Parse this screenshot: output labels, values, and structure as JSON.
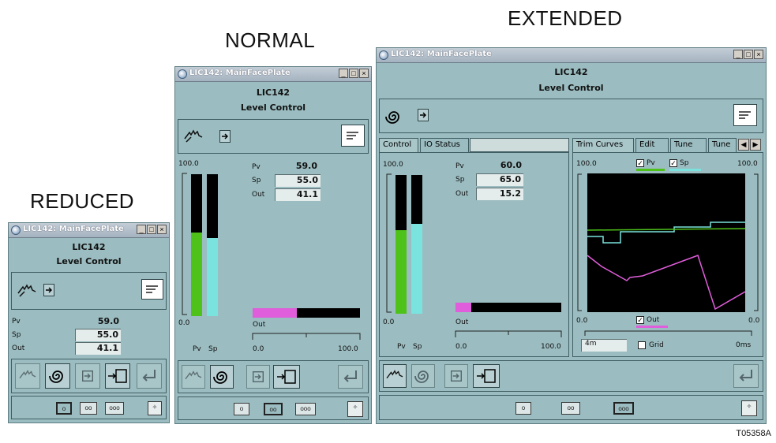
{
  "labels": {
    "reduced": "REDUCED",
    "normal": "NORMAL",
    "extended": "EXTENDED",
    "figure_id": "T05358A"
  },
  "window": {
    "title": "LIC142: MainFacePlate",
    "tag": "LIC142",
    "description": "Level Control",
    "min": "_",
    "max": "□",
    "close": "×"
  },
  "reduced": {
    "pv_label": "Pv",
    "pv": "59.0",
    "sp_label": "Sp",
    "sp": "55.0",
    "out_label": "Out",
    "out": "41.1"
  },
  "normal": {
    "scale_top": "100.0",
    "scale_bottom": "0.0",
    "pv_label": "Pv",
    "pv": "59.0",
    "sp_label": "Sp",
    "sp": "55.0",
    "out_label": "Out",
    "out": "41.1",
    "bar_pv_label": "Pv",
    "bar_sp_label": "Sp",
    "out_bar_label": "Out",
    "out_scale_min": "0.0",
    "out_scale_max": "100.0",
    "pv_level": 0.59,
    "sp_level": 0.55,
    "out_level": 0.411
  },
  "extended": {
    "tabs_left": [
      "Control",
      "IO Status"
    ],
    "tabs_right": [
      "Trim Curves",
      "Edit",
      "Tune",
      "Tune"
    ],
    "scale_top": "100.0",
    "scale_bottom": "0.0",
    "pv_label": "Pv",
    "pv": "60.0",
    "sp_label": "Sp",
    "sp": "65.0",
    "out_label": "Out",
    "out": "15.2",
    "bar_pv_label": "Pv",
    "bar_sp_label": "Sp",
    "out_bar_label": "Out",
    "out_scale_min": "0.0",
    "out_scale_max": "100.0",
    "pv_level": 0.6,
    "sp_level": 0.65,
    "out_level": 0.152,
    "trend": {
      "left_top": "100.0",
      "right_top": "100.0",
      "left_bottom": "0.0",
      "right_bottom": "0.0",
      "legend_pv": "Pv",
      "legend_sp": "Sp",
      "legend_out": "Out",
      "time_value": "4m",
      "grid_label": "Grid",
      "time_end": "0ms"
    }
  },
  "view_buttons": [
    "o",
    "oo",
    "ooo"
  ],
  "colors": {
    "pv": "#4fc21a",
    "sp": "#7be3de",
    "out": "#e05ddb",
    "window_bg": "#9bbcc0"
  }
}
